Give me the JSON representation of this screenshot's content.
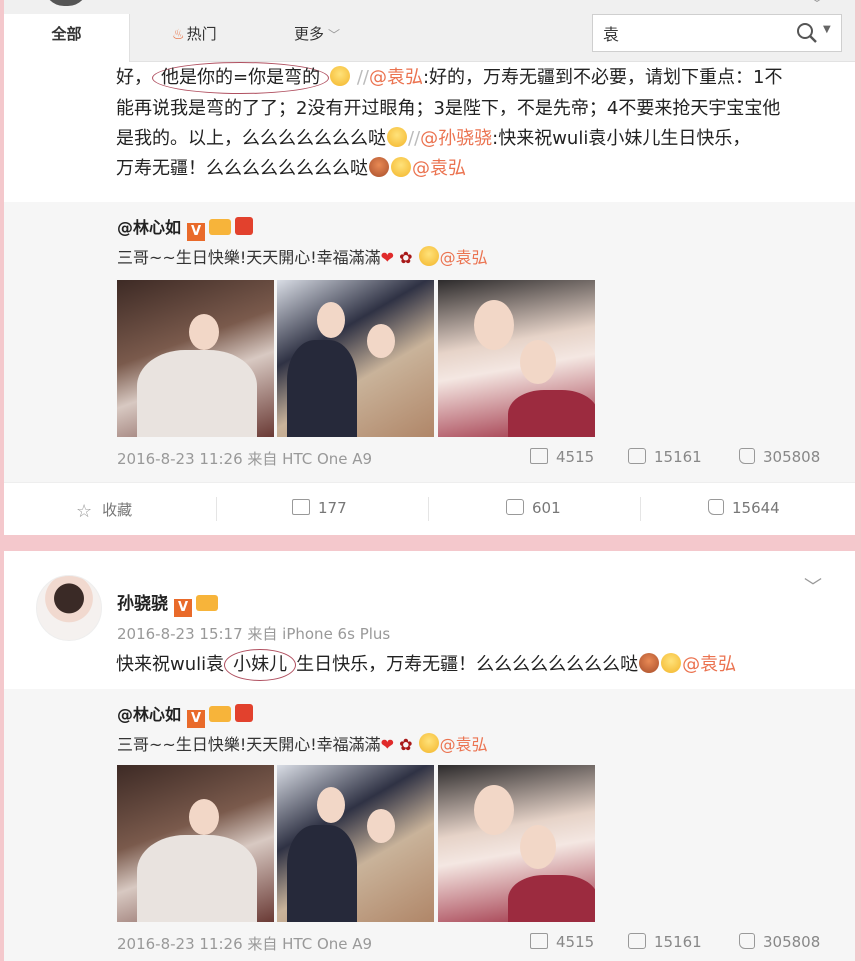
{
  "search": {
    "value": "袁"
  },
  "tabs": {
    "all": "全部",
    "hot": "热门",
    "more": "更多"
  },
  "post1": {
    "line1_pre": "好，",
    "line1_circled": "他是你的=你是弯的",
    "line1_sep": "//",
    "line1_mention": "@袁弘",
    "line1_post": ":好的，万寿无疆到不必要，请划下重点：1不",
    "line2": "能再说我是弯的了了；2没有开过眼角；3是陛下，不是先帝；4不要来抢天宇宝宝他",
    "line3_pre": "是我的。以上，么么么么么么么哒",
    "line3_sep": "//",
    "line3_mention": "@孙骁骁",
    "line3_post": ":快来祝wuli袁小妹儿生日快乐，",
    "line4_pre": "万寿无疆！么么么么么么么么哒",
    "line4_mention": "@袁弘"
  },
  "quote": {
    "author": "@林心如",
    "v_badge": "V",
    "text": "三哥~~生日快樂!天天開心!幸福滿滿",
    "mention": "@袁弘",
    "meta": "2016-8-23 11:26 来自 HTC One A9",
    "forwards": "4515",
    "comments": "15161",
    "likes": "305808"
  },
  "actions": {
    "favorite": "收藏",
    "forward": "177",
    "comment": "601",
    "like": "15644"
  },
  "post2": {
    "author": "孙骁骁",
    "v_badge": "V",
    "meta": "2016-8-23 15:17 来自 iPhone 6s Plus",
    "text_pre": "快来祝wuli袁",
    "text_circled": "小妹儿",
    "text_post": "生日快乐，万寿无疆！么么么么么么么么哒",
    "mention": "@袁弘"
  }
}
